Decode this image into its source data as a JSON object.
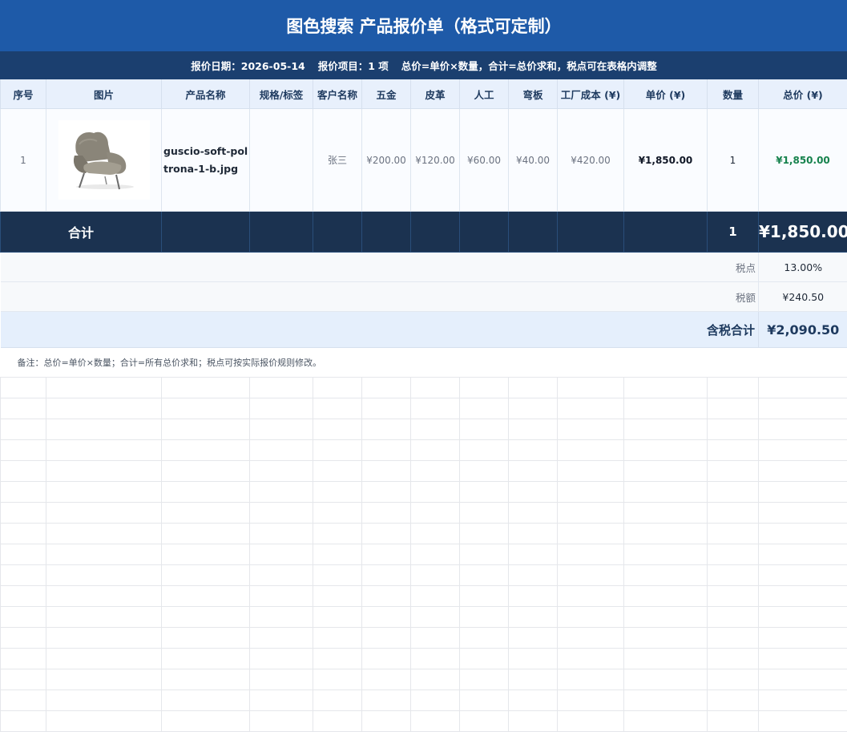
{
  "title": "图色搜索 产品报价单（格式可定制）",
  "subheader": {
    "date": "报价日期：2026-05-14",
    "items": "报价项目：1 项",
    "formula": "总价=单价×数量，合计=总价求和，税点可在表格内调整"
  },
  "columns": [
    "序号",
    "图片",
    "产品名称",
    "规格/标签",
    "客户名称",
    "五金",
    "皮革",
    "人工",
    "弯板",
    "工厂成本 (¥)",
    "单价 (¥)",
    "数量",
    "总价 (¥)"
  ],
  "rows": [
    {
      "seq": "1",
      "image_icon": "armchair-image",
      "name": "guscio-soft-poltrona-1-b.jpg",
      "spec": "",
      "customer": "张三",
      "hardware": "¥200.00",
      "leather": "¥120.00",
      "labor": "¥60.00",
      "bending": "¥40.00",
      "factory_cost": "¥420.00",
      "unit_price": "¥1,850.00",
      "qty": "1",
      "total": "¥1,850.00"
    }
  ],
  "totals": {
    "label": "合计",
    "qty": "1",
    "amount": "¥1,850.00"
  },
  "tax": {
    "rate_label": "税点",
    "rate": "13.00%",
    "amount_label": "税额",
    "amount": "¥240.50"
  },
  "grand": {
    "label": "含税合计",
    "amount": "¥2,090.50"
  },
  "note": "备注：总价=单价×数量；合计=所有总价求和；税点可按实际报价规则修改。",
  "colors": {
    "title_bg": "#1e5aa8",
    "subheader_bg": "#1b3f6f",
    "total_bg": "#1b3250",
    "accent_green": "#16824d"
  }
}
